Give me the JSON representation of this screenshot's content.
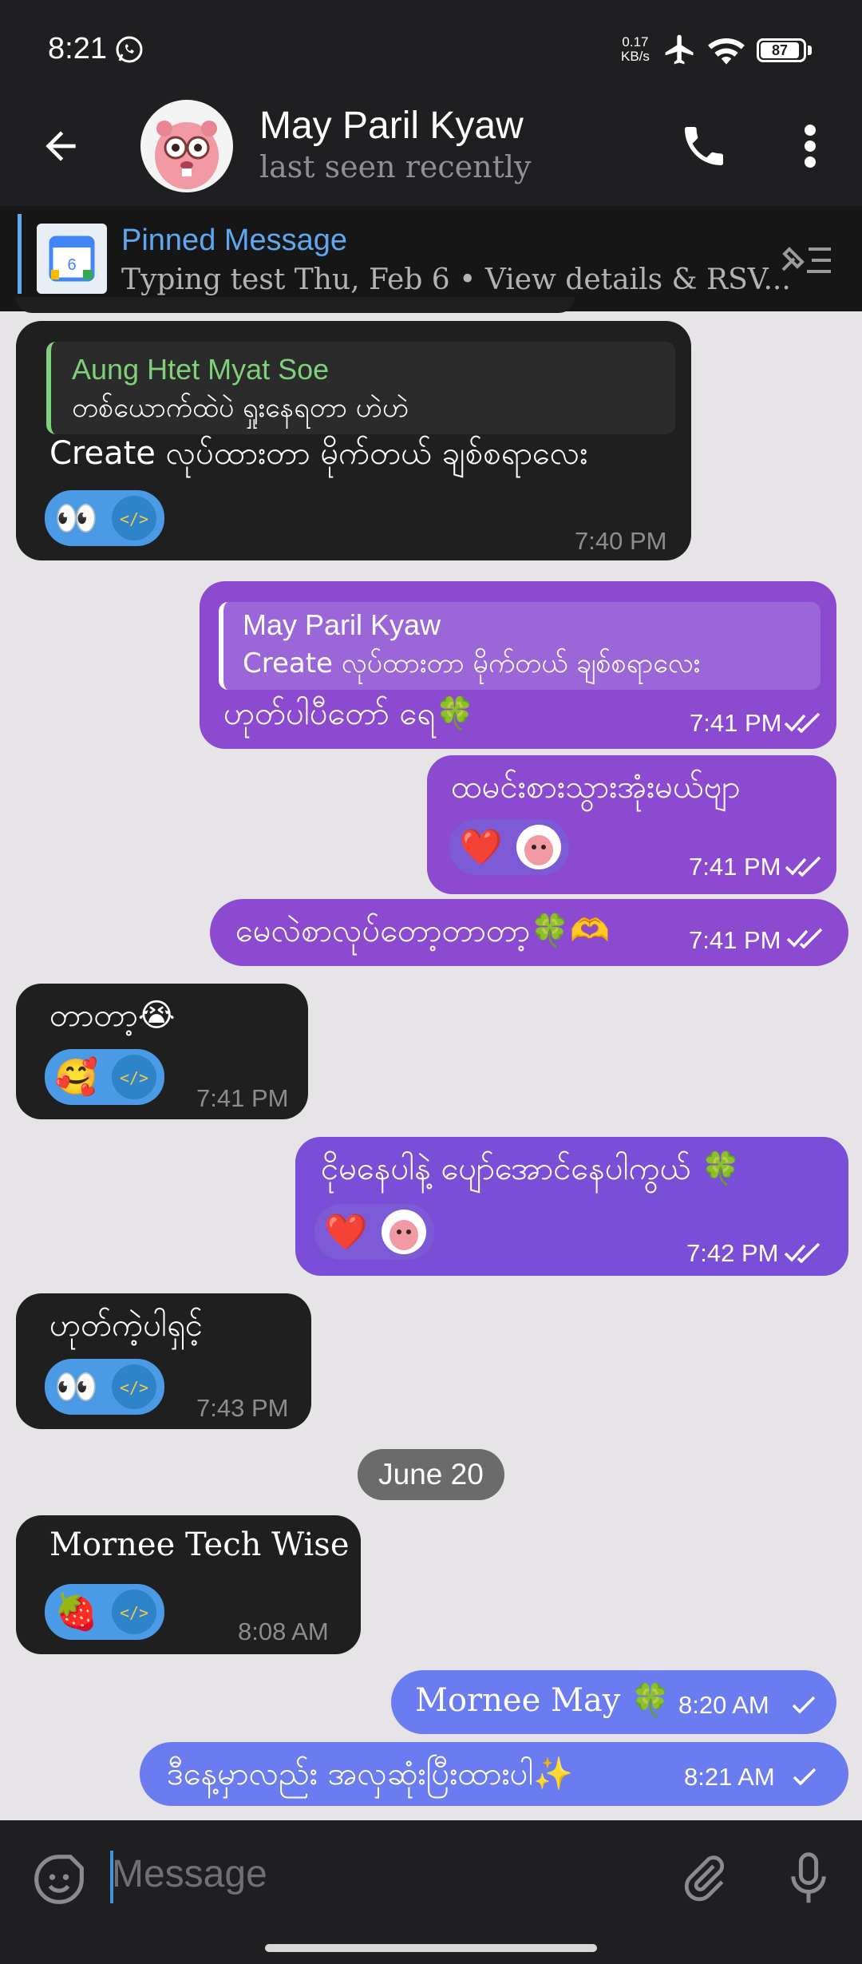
{
  "status_bar": {
    "time": "8:21",
    "net_speed_value": "0.17",
    "net_speed_unit": "KB/s",
    "battery": "87"
  },
  "header": {
    "name": "May Paril Kyaw",
    "last_seen": "last seen recently",
    "icons": [
      "back-arrow-icon",
      "phone-icon",
      "more-vert-icon"
    ]
  },
  "pinned": {
    "title": "Pinned Message",
    "subtitle": "Typing test Thu, Feb 6 • View details & RSV..."
  },
  "messages": [
    {
      "dir": "in",
      "quote_name": "Aung Htet Myat Soe",
      "quote_text": "တစ်ယောက်ထဲပဲ ရှုးနေရတာ ဟဲဟဲ",
      "text": "Create လုပ်ထားတာ မိုက်တယ် ချစ်စရာလေး",
      "reactions": [
        "👀",
        "</>"
      ],
      "time": "7:40 PM"
    },
    {
      "dir": "out",
      "quote_name": "May Paril Kyaw",
      "quote_text": "Create လုပ်ထားတာ မိုက်တယ် ချစ်စရာလေး",
      "text": "ဟုတ်ပါပီတော် ရေ🍀",
      "time": "7:41 PM"
    },
    {
      "dir": "out",
      "text": "ထမင်းစားသွားအုံးမယ်ဗျာ",
      "reactions": [
        "❤️",
        "avatar"
      ],
      "time": "7:41 PM"
    },
    {
      "dir": "out",
      "text": "မေလဲစာလုပ်တော့တာတာ့🍀🫶",
      "time": "7:41 PM"
    },
    {
      "dir": "in",
      "text": "တာတာ့😭",
      "reactions": [
        "🥰",
        "</>"
      ],
      "time": "7:41 PM"
    },
    {
      "dir": "out",
      "text": "ငိုမနေပါနဲ့ ပျော်အောင်နေပါကွယ် 🍀",
      "reactions": [
        "❤️",
        "avatar"
      ],
      "time": "7:42 PM"
    },
    {
      "dir": "in",
      "text": "ဟုတ်ကဲ့ပါရှင့်",
      "reactions": [
        "👀",
        "</>"
      ],
      "time": "7:43 PM"
    },
    {
      "dir": "in",
      "text": "Mornee Tech Wise",
      "reactions": [
        "🍓",
        "</>"
      ],
      "time": "8:08 AM"
    },
    {
      "dir": "out",
      "text": "Mornee  May 🍀",
      "time": "8:20 AM"
    },
    {
      "dir": "out",
      "text": "ဒီနေ့မှာလည်း အလှဆုံးပြီးထားပါ✨",
      "time": "8:21 AM"
    }
  ],
  "date_separator": "June 20",
  "input": {
    "placeholder": "Message"
  },
  "colors": {
    "header_bg": "#1f1f21",
    "incoming_bubble": "#1f1f1f",
    "outgoing_bubble": "#8c4ad1",
    "outgoing_bubble_blue": "#6b7cf0",
    "accent": "#5fa7ef",
    "quote_name_green": "#7ed07a"
  }
}
